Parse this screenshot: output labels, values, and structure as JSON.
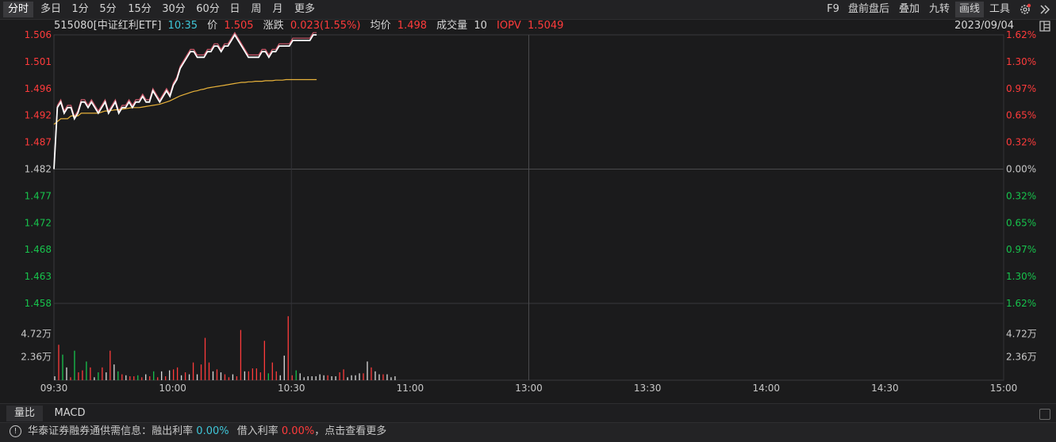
{
  "toolbar": {
    "tabs": [
      "分时",
      "多日",
      "1分",
      "5分",
      "15分",
      "30分",
      "60分",
      "日",
      "周",
      "月",
      "更多"
    ],
    "right": [
      "F9",
      "盘前盘后",
      "叠加",
      "九转",
      "画线",
      "工具"
    ]
  },
  "info": {
    "code_name": "515080[中证红利ETF]",
    "time": "10:35",
    "price_label": "价",
    "price": "1.505",
    "change_label": "涨跌",
    "change": "0.023(1.55%)",
    "avg_label": "均价",
    "avg": "1.498",
    "volume_label": "成交量",
    "volume": "10",
    "iopv_label": "IOPV",
    "iopv": "1.5049",
    "date": "2023/09/04"
  },
  "axes": {
    "price_ticks": [
      "1.506",
      "1.501",
      "1.496",
      "1.492",
      "1.487",
      "1.482",
      "1.477",
      "1.472",
      "1.468",
      "1.463",
      "1.458"
    ],
    "pct_ticks": [
      "1.62%",
      "1.30%",
      "0.97%",
      "0.65%",
      "0.32%",
      "0.00%",
      "0.32%",
      "0.65%",
      "0.97%",
      "1.30%",
      "1.62%"
    ],
    "vol_ticks": [
      "4.72万",
      "2.36万"
    ],
    "time_ticks": [
      "09:30",
      "10:00",
      "10:30",
      "11:00",
      "13:00",
      "13:30",
      "14:00",
      "14:30",
      "15:00"
    ]
  },
  "bottom_tabs": [
    "量比",
    "MACD"
  ],
  "status": {
    "prefix": "华泰证券融券通供需信息：融出利率",
    "lend_rate": "0.00%",
    "borrow_label": "借入利率",
    "borrow_rate": "0.00%",
    "suffix": "，点击查看更多"
  },
  "colors": {
    "up": "#ff3b3b",
    "down": "#17c34c",
    "flat": "#c8c8c8",
    "avg_line": "#e8b23a",
    "price_line": "#ffffff",
    "time_accent": "#3fc6d8"
  },
  "chart_data": {
    "type": "line",
    "prev_close": 1.482,
    "ylim": [
      1.458,
      1.506
    ],
    "x_label": "",
    "series": [
      {
        "values": [
          1.482,
          1.493,
          1.494,
          1.492,
          1.493,
          1.493,
          1.491,
          1.492,
          1.494,
          1.494,
          1.493,
          1.494,
          1.493,
          1.492,
          1.493,
          1.494,
          1.492,
          1.493,
          1.494,
          1.492,
          1.493,
          1.493,
          1.494,
          1.493,
          1.494,
          1.494,
          1.495,
          1.494,
          1.494,
          1.496,
          1.495,
          1.494,
          1.495,
          1.496,
          1.495,
          1.497,
          1.498,
          1.5,
          1.501,
          1.502,
          1.503,
          1.503,
          1.502,
          1.502,
          1.502,
          1.503,
          1.503,
          1.504,
          1.504,
          1.503,
          1.504,
          1.504,
          1.505,
          1.506,
          1.505,
          1.504,
          1.503,
          1.502,
          1.502,
          1.502,
          1.502,
          1.503,
          1.503,
          1.502,
          1.503,
          1.503,
          1.504,
          1.504,
          1.504,
          1.504,
          1.505,
          1.505,
          1.505,
          1.505,
          1.505,
          1.505,
          1.506,
          1.506
        ]
      },
      {
        "values": [
          1.49,
          1.4905,
          1.491,
          1.491,
          1.491,
          1.4915,
          1.4915,
          1.4915,
          1.492,
          1.492,
          1.492,
          1.492,
          1.492,
          1.492,
          1.4922,
          1.4924,
          1.4924,
          1.4925,
          1.4926,
          1.4926,
          1.4927,
          1.4928,
          1.4929,
          1.493,
          1.493,
          1.493,
          1.4931,
          1.4932,
          1.4933,
          1.4934,
          1.4935,
          1.4936,
          1.4938,
          1.494,
          1.4942,
          1.4945,
          1.4948,
          1.4951,
          1.4953,
          1.4955,
          1.4957,
          1.4959,
          1.496,
          1.4962,
          1.4963,
          1.4965,
          1.4966,
          1.4967,
          1.4968,
          1.4969,
          1.497,
          1.4971,
          1.4972,
          1.4973,
          1.4974,
          1.4975,
          1.4975,
          1.4976,
          1.4976,
          1.4977,
          1.4977,
          1.4977,
          1.4978,
          1.4978,
          1.4978,
          1.4979,
          1.4979,
          1.4979,
          1.498,
          1.498,
          1.498,
          1.498,
          1.498,
          1.498,
          1.498,
          1.498,
          1.498,
          1.498
        ]
      }
    ],
    "volume": [
      0.4,
      3.6,
      2.6,
      1.3,
      0.3,
      3.0,
      0.8,
      1.0,
      1.9,
      1.3,
      0.3,
      0.8,
      1.3,
      0.8,
      3.0,
      1.6,
      0.9,
      0.6,
      0.5,
      0.4,
      0.4,
      0.5,
      0.3,
      0.6,
      0.4,
      0.9,
      0.3,
      0.9,
      0.4,
      1.0,
      1.1,
      1.3,
      0.5,
      0.8,
      0.6,
      1.8,
      0.6,
      1.6,
      4.3,
      1.8,
      0.9,
      1.1,
      0.8,
      0.6,
      0.3,
      0.6,
      0.4,
      5.1,
      0.9,
      0.9,
      1.2,
      1.2,
      0.8,
      4.0,
      0.7,
      1.8,
      0.9,
      0.5,
      2.5,
      6.5,
      0.5,
      1.0,
      0.7,
      0.3,
      0.4,
      0.4,
      0.4,
      0.6,
      0.5,
      0.5,
      0.4,
      0.4,
      0.8,
      1.1,
      0.3,
      0.5,
      0.5,
      0.7,
      0.7,
      1.9,
      1.3,
      0.9,
      0.6,
      0.6,
      0.6,
      0.3,
      0.4
    ],
    "volume_dir": [
      0,
      1,
      -1,
      0,
      1,
      -1,
      1,
      1,
      -1,
      1,
      0,
      -1,
      1,
      0,
      1,
      0,
      -1,
      1,
      0,
      1,
      1,
      -1,
      1,
      0,
      1,
      -1,
      1,
      0,
      1,
      0,
      1,
      1,
      0,
      1,
      0,
      1,
      0,
      1,
      1,
      1,
      0,
      1,
      0,
      1,
      1,
      0,
      1,
      1,
      0,
      1,
      1,
      1,
      1,
      1,
      -1,
      1,
      1,
      0,
      0,
      1,
      1,
      -1,
      0,
      0,
      0,
      0,
      0,
      0,
      0,
      1,
      0,
      0,
      1,
      1,
      0,
      0,
      0,
      0,
      1,
      0,
      1,
      0,
      0,
      1,
      0,
      0,
      0
    ]
  }
}
